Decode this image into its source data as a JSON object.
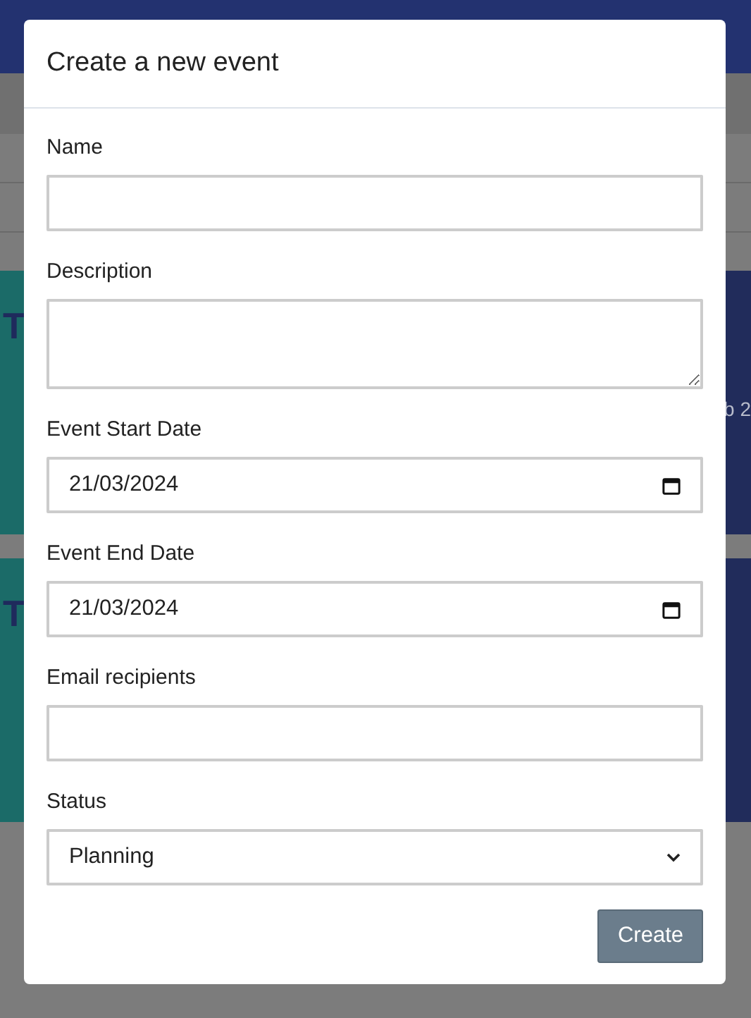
{
  "background": {
    "cards": [
      {
        "title": "T",
        "color": "#1b6b68"
      },
      {
        "subtitle": "b 2",
        "color": "#212c5b"
      },
      {
        "title": "T",
        "color": "#1b6b68"
      },
      {
        "color": "#212c5b"
      }
    ]
  },
  "dialog": {
    "title": "Create a new event",
    "fields": [
      {
        "kind": "text",
        "label": "Name"
      },
      {
        "kind": "textarea",
        "label": "Description"
      },
      {
        "kind": "date",
        "label": "Event Start Date",
        "value": "21/03/2024"
      },
      {
        "kind": "date",
        "label": "Event End Date",
        "value": "21/03/2024"
      },
      {
        "kind": "text",
        "label": "Email recipients"
      },
      {
        "kind": "select",
        "label": "Status",
        "value": "Planning"
      }
    ],
    "button": "Create"
  }
}
